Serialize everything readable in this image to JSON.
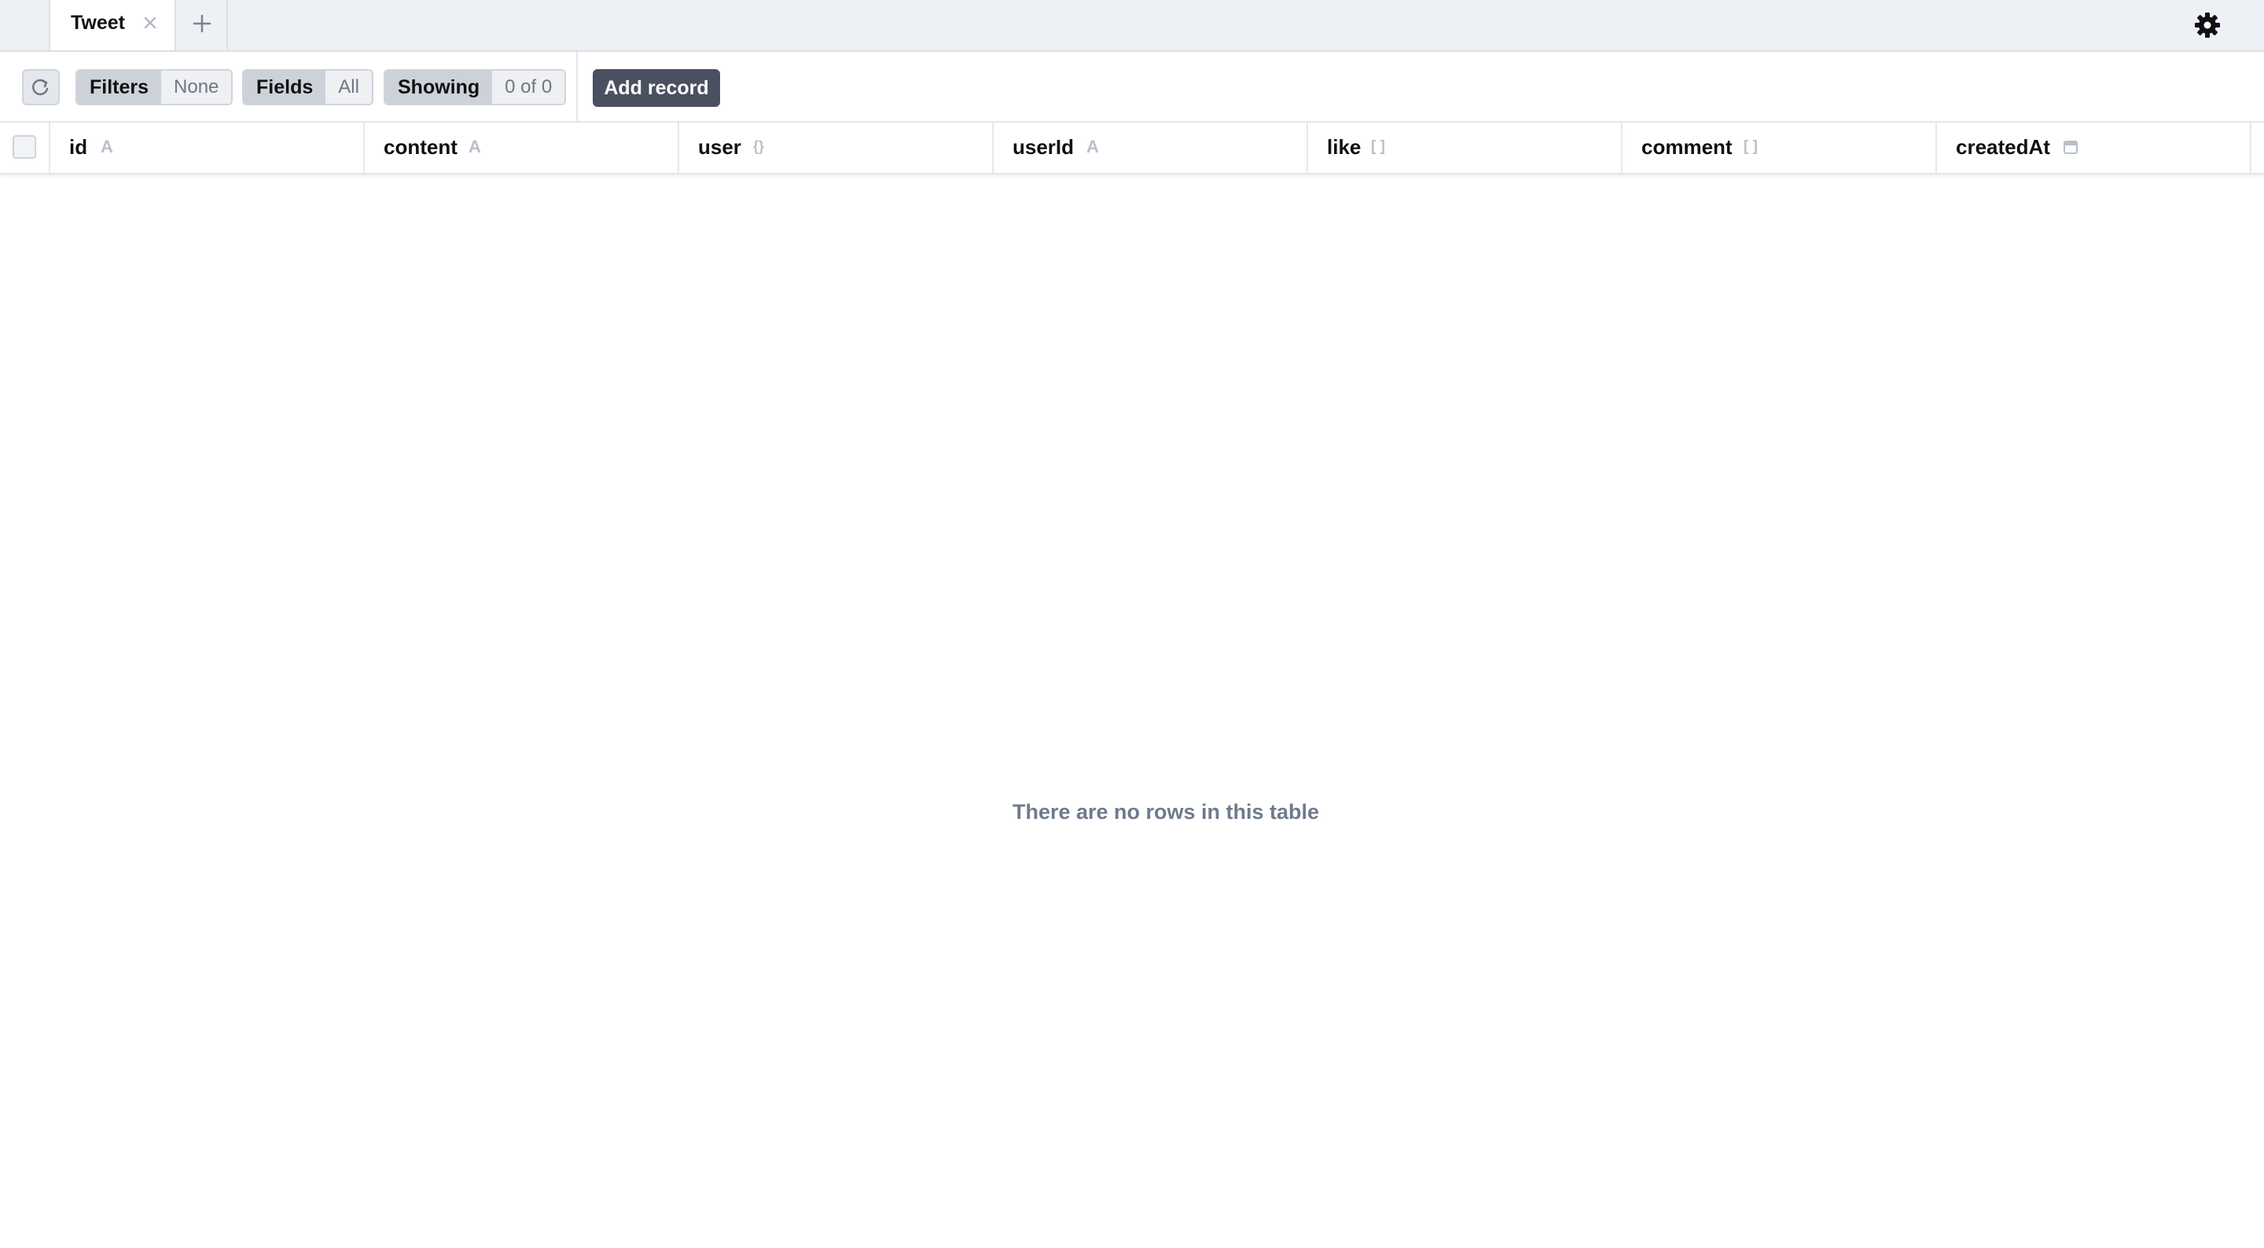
{
  "tabs": [
    {
      "label": "Tweet",
      "active": true
    }
  ],
  "toolbar": {
    "filters_label": "Filters",
    "filters_value": "None",
    "fields_label": "Fields",
    "fields_value": "All",
    "showing_label": "Showing",
    "showing_value": "0 of 0",
    "add_record_label": "Add record"
  },
  "columns": [
    {
      "name": "id",
      "type_icon": "A"
    },
    {
      "name": "content",
      "type_icon": "A"
    },
    {
      "name": "user",
      "type_icon": "{}"
    },
    {
      "name": "userId",
      "type_icon": "A"
    },
    {
      "name": "like",
      "type_icon": "[ ]"
    },
    {
      "name": "comment",
      "type_icon": "[ ]"
    },
    {
      "name": "createdAt",
      "type_icon": "calendar-icon"
    }
  ],
  "empty_message": "There are no rows in this table",
  "colors": {
    "tabbar_bg": "#edf0f5",
    "add_button_bg": "#4a5060",
    "empty_text": "#6f7b8c"
  }
}
